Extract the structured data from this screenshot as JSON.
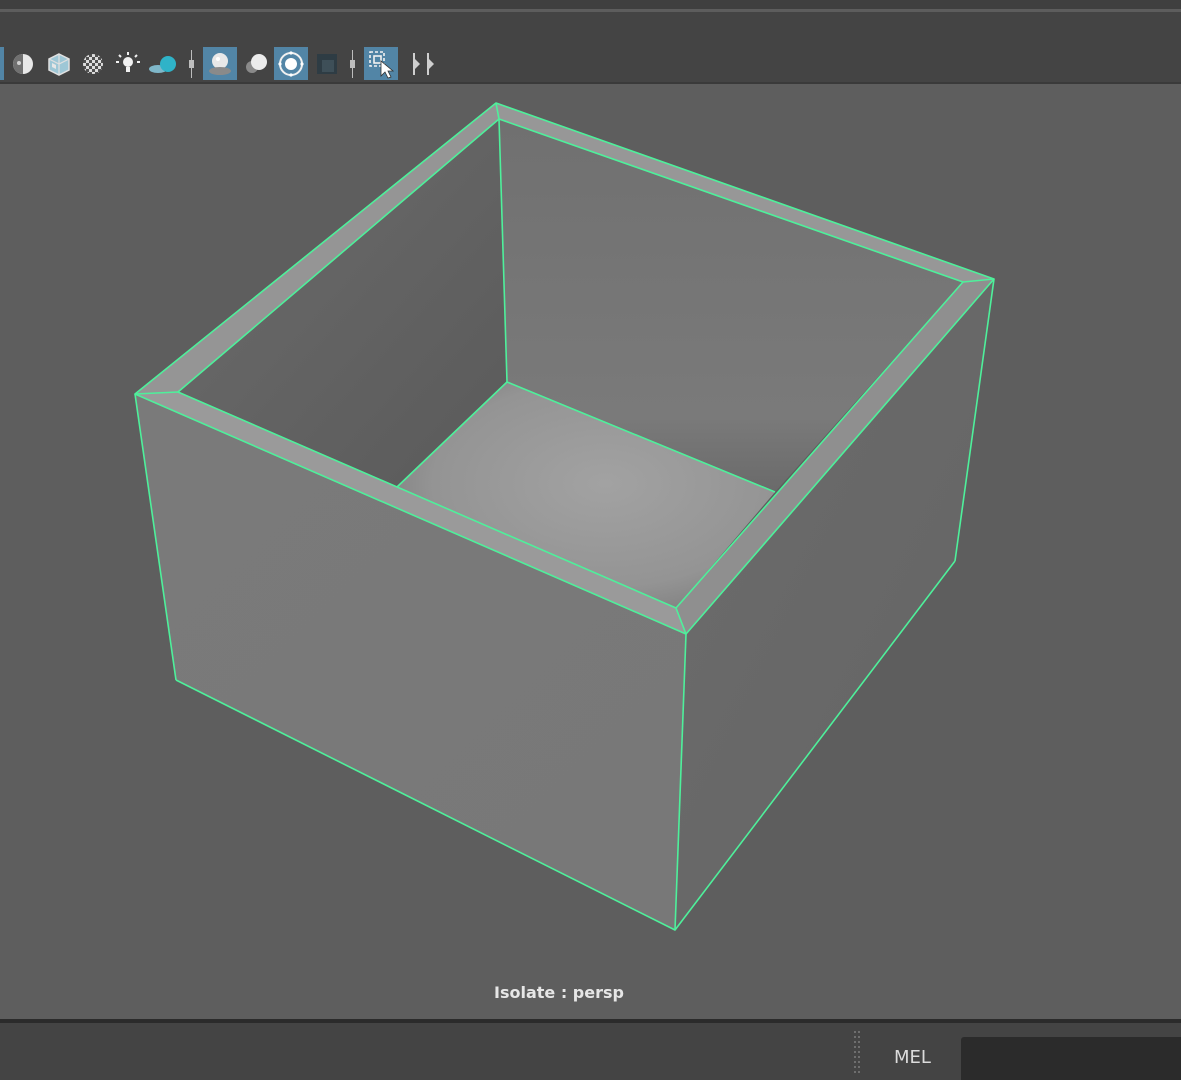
{
  "toolbar": {
    "icons": [
      {
        "name": "shaded-sphere-icon",
        "active": false
      },
      {
        "name": "textured-icon",
        "active": false
      },
      {
        "name": "checker-icon",
        "active": false
      },
      {
        "name": "light-icon",
        "active": false
      },
      {
        "name": "shadow-icon",
        "active": false
      },
      {
        "name": "screen-space-ao-icon",
        "active": true
      },
      {
        "name": "motion-blur-icon",
        "active": false
      },
      {
        "name": "anti-aliasing-icon",
        "active": true
      },
      {
        "name": "depth-of-field-icon",
        "active": false
      },
      {
        "name": "isolate-select-icon",
        "active": true
      },
      {
        "name": "xray-icon",
        "active": false
      }
    ],
    "accent_color": "#5285a6"
  },
  "viewport": {
    "label": "Isolate : persp",
    "background": "#5e5e5e",
    "wire_color": "#4ef09b"
  },
  "command_line": {
    "language_label": "MEL",
    "value": ""
  }
}
